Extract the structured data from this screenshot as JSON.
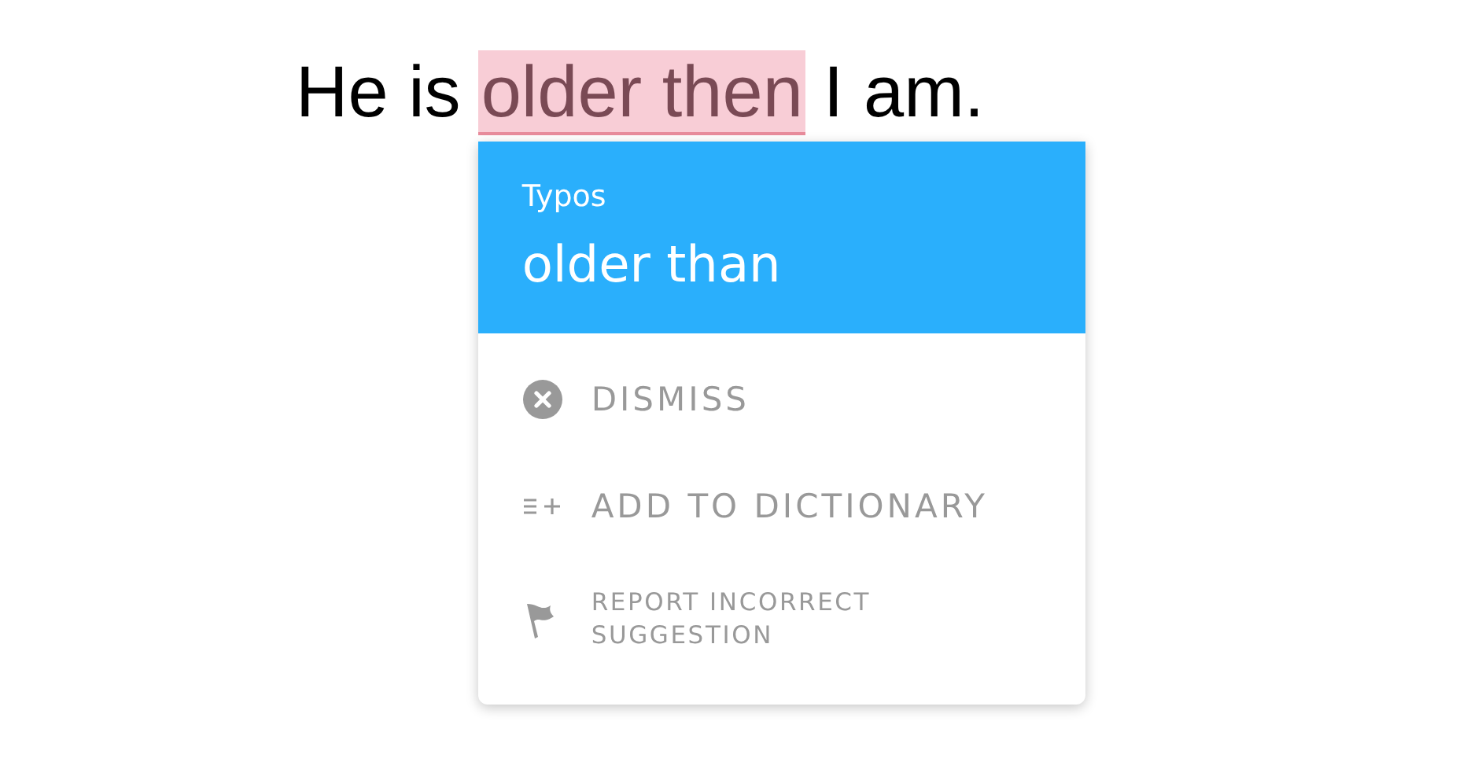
{
  "sentence": {
    "before": "He is",
    "flagged": "older then",
    "after": "I am."
  },
  "popup": {
    "category": "Typos",
    "suggestion": "older than",
    "actions": [
      {
        "kind": "dismiss",
        "label": "DISMISS"
      },
      {
        "kind": "dictionary",
        "label": "ADD TO DICTIONARY"
      },
      {
        "kind": "report",
        "label": "REPORT INCORRECT SUGGESTION"
      }
    ]
  }
}
